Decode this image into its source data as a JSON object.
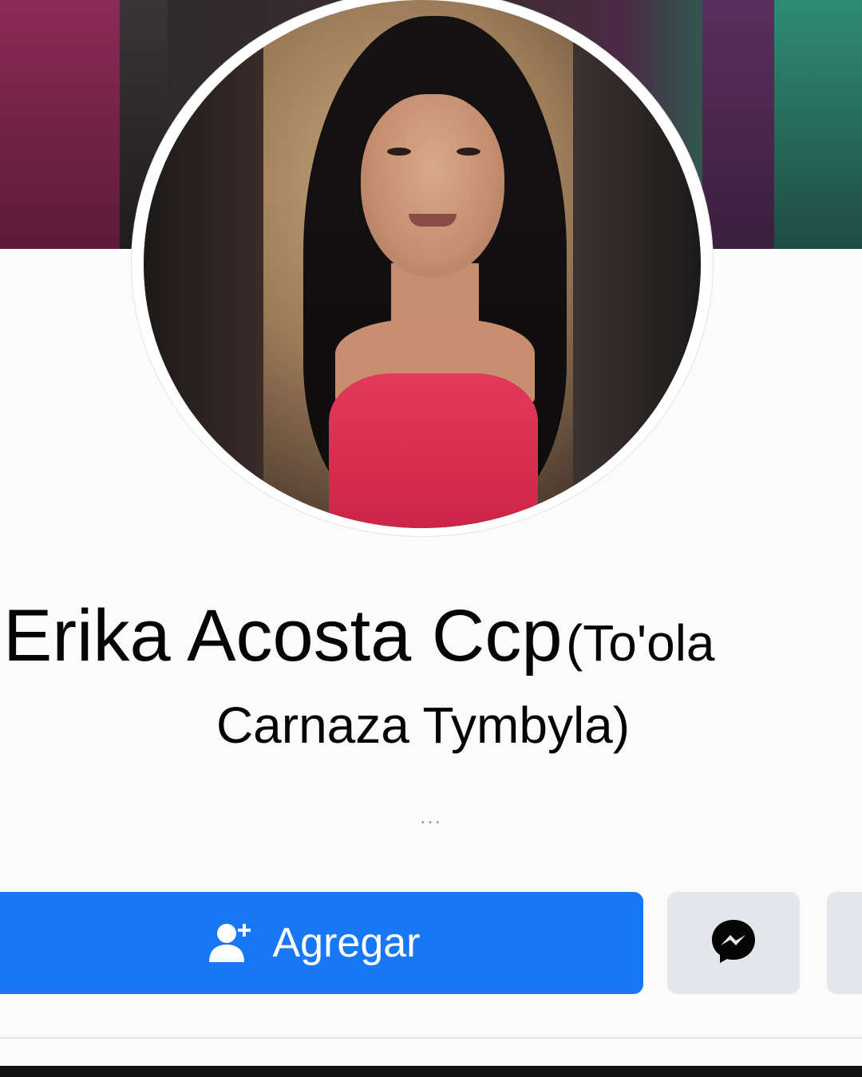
{
  "profile": {
    "name_main": "Erika Acosta Ccp",
    "name_alt_line1": "(To'ola",
    "name_alt_line2": "Carnaza Tymbyla)",
    "more_indicator": "..."
  },
  "actions": {
    "add_friend_label": "Agregar",
    "add_friend_icon": "add-person-icon",
    "message_icon": "messenger-icon"
  },
  "colors": {
    "primary_button": "#1877f2",
    "secondary_button": "#e4e6eb",
    "name_text": "#050505"
  }
}
